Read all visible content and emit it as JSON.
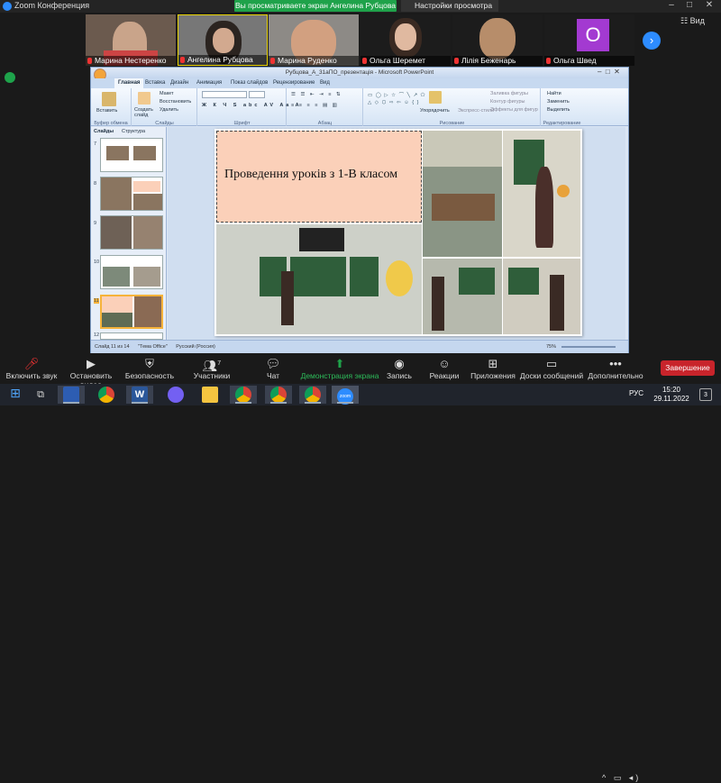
{
  "window": {
    "title": "Zoom Конференция"
  },
  "share": {
    "banner": "Вы просматриваете экран Ангелина Рубцова",
    "view_options": "Настройки просмотра"
  },
  "gallery": {
    "view_label": "Вид",
    "participants": [
      {
        "name": "Марина Нестеренко"
      },
      {
        "name": "Ангелина Рубцова"
      },
      {
        "name": "Марина Руденко"
      },
      {
        "name": "Ольга Шеремет"
      },
      {
        "name": "Лілія Беженарь"
      },
      {
        "name": "Ольга Швед",
        "avatar_letter": "О"
      }
    ]
  },
  "ppt": {
    "title": "Рубцова_А_31аПО_презентація - Microsoft PowerPoint",
    "tabs": [
      "Главная",
      "Вставка",
      "Дизайн",
      "Анимация",
      "Показ слайдов",
      "Рецензирование",
      "Вид"
    ],
    "groups": [
      "Буфер обмена",
      "Слайды",
      "Шрифт",
      "Абзац",
      "Рисование",
      "Редактирование"
    ],
    "buttons": {
      "paste": "Вставить",
      "new_slide": "Создать слайд",
      "layout": "Макет",
      "reset": "Восстановить",
      "delete": "Удалить",
      "arrange": "Упорядочить",
      "quick_styles": "Экспресс-стили",
      "find": "Найти",
      "replace": "Заменить",
      "select": "Выделить",
      "fill": "Заливка фигуры",
      "outline": "Контур фигуры",
      "effects": "Эффекты для фигур"
    },
    "panel_tabs": [
      "Слайды",
      "Структура"
    ],
    "thumb_numbers": [
      "7",
      "8",
      "9",
      "10",
      "11",
      "12"
    ],
    "slide_title": "Проведення уроків з 1-В класом",
    "status": {
      "slide": "Слайд 11 из 14",
      "theme": "\"Тема Office\"",
      "lang": "Русский (Россия)",
      "zoom": "75%"
    }
  },
  "toolbar": {
    "unmute": "Включить звук",
    "video": "Остановить видео",
    "security": "Безопасность",
    "participants": "Участники",
    "participants_count": "7",
    "chat": "Чат",
    "share": "Демонстрация экрана",
    "record": "Запись",
    "reactions": "Реакции",
    "apps": "Приложения",
    "whiteboard": "Доски сообщений",
    "more": "Дополнительно",
    "end": "Завершение"
  },
  "taskbar": {
    "lang": "РУС",
    "time": "15:20",
    "date": "29.11.2022",
    "notif": "3"
  },
  "colors": {
    "share_green": "#1fa24a",
    "zoom_blue": "#2d8cff",
    "end_red": "#c8242b",
    "title_box": "#fbd0b9"
  }
}
